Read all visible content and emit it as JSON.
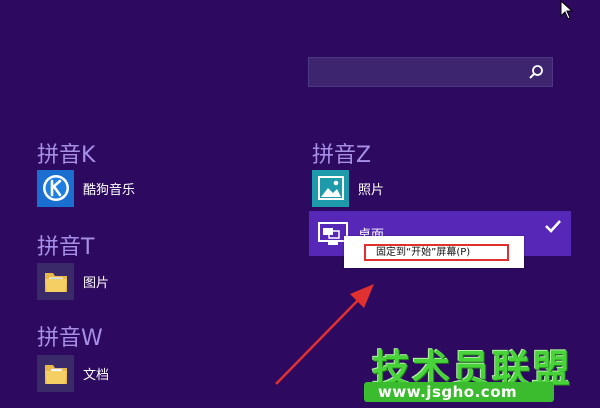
{
  "search": {
    "value": "",
    "placeholder": ""
  },
  "groups": [
    {
      "title": "拼音K",
      "items": [
        {
          "label": "酷狗音乐",
          "icon": "kugou-music-icon"
        }
      ]
    },
    {
      "title": "拼音T",
      "items": [
        {
          "label": "图片",
          "icon": "folder-icon"
        }
      ]
    },
    {
      "title": "拼音W",
      "items": [
        {
          "label": "文档",
          "icon": "folder-icon"
        }
      ]
    },
    {
      "title": "拼音Z",
      "items": [
        {
          "label": "照片",
          "icon": "photos-icon"
        },
        {
          "label": "桌面",
          "icon": "desktop-icon",
          "selected": true
        }
      ]
    }
  ],
  "context_menu": {
    "pin_label": "固定到“开始”屏幕(P)"
  },
  "watermark": {
    "title": "技术员联盟",
    "url": "www.jsgho.com"
  },
  "colors": {
    "background": "#2d0a5f",
    "group_title": "#a58fe7",
    "selected_tile": "#5727b8",
    "highlight_border": "#e03030",
    "watermark_green": "#49d33b"
  }
}
